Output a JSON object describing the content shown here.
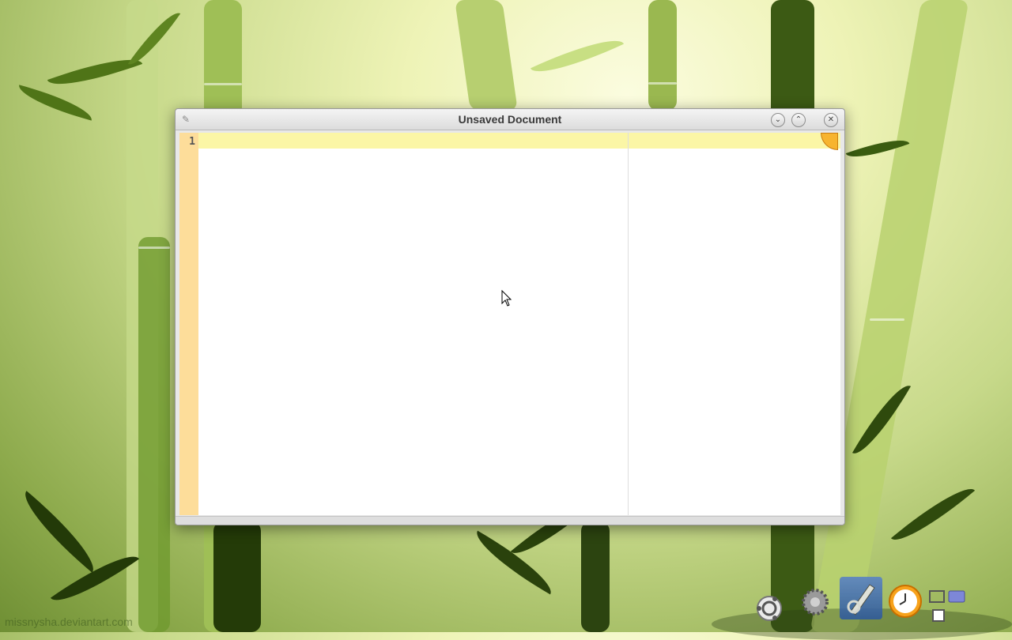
{
  "window": {
    "title": "Unsaved Document"
  },
  "editor": {
    "line_numbers": [
      "1"
    ],
    "content": ""
  },
  "dock": {
    "items": [
      {
        "icon": "ubuntu-logo-icon"
      },
      {
        "icon": "settings-gear-icon"
      },
      {
        "icon": "text-editor-pen-icon"
      },
      {
        "icon": "clock-icon"
      },
      {
        "icon": "window-switcher-icon"
      }
    ]
  },
  "wallpaper": {
    "credit": "missnysha.deviantart.com"
  }
}
